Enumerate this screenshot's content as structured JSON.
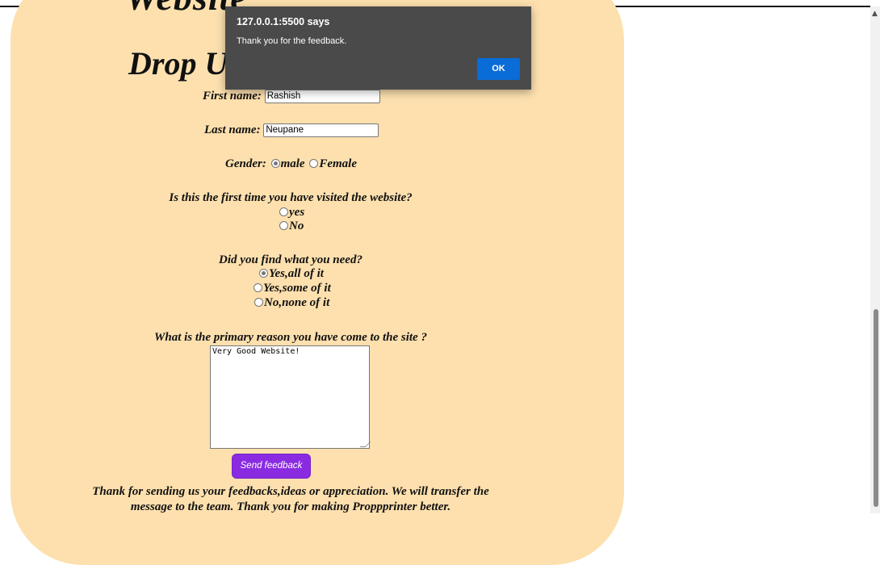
{
  "page": {
    "heading_partial": "Website",
    "heading_main": "Drop Us a Line"
  },
  "form": {
    "first_name_label": "First name:",
    "first_name_value": "Rashish",
    "last_name_label": "Last name:",
    "last_name_value": "Neupane",
    "gender_label": "Gender:",
    "gender_options": [
      {
        "label": "male",
        "checked": true
      },
      {
        "label": "Female",
        "checked": false
      }
    ],
    "first_visit_question": "Is this the first time you have visited the website?",
    "first_visit_options": [
      {
        "label": "yes",
        "checked": false
      },
      {
        "label": "No",
        "checked": false
      }
    ],
    "found_question": "Did you find what you need?",
    "found_options": [
      {
        "label": "Yes,all of it",
        "checked": true
      },
      {
        "label": "Yes,some of it",
        "checked": false
      },
      {
        "label": "No,none of it",
        "checked": false
      }
    ],
    "reason_question": "What is the primary reason you have come to the site ?",
    "reason_value": "Very Good Website!",
    "send_button": "Send feedback",
    "footer_line1": "Thank for sending us your feedbacks,ideas or appreciation. We will transfer the",
    "footer_line2": "message to the team. Thank you for making Proppprinter better."
  },
  "dialog": {
    "title": "127.0.0.1:5500 says",
    "message": "Thank you for the feedback.",
    "ok_label": "OK"
  },
  "scrollbar": {
    "up_icon": "▲"
  },
  "colors": {
    "card_bg": "#fde0ae",
    "button_bg": "#8a2be2",
    "dialog_bg": "#4a4a4a",
    "ok_bg": "#0a6cd6"
  }
}
